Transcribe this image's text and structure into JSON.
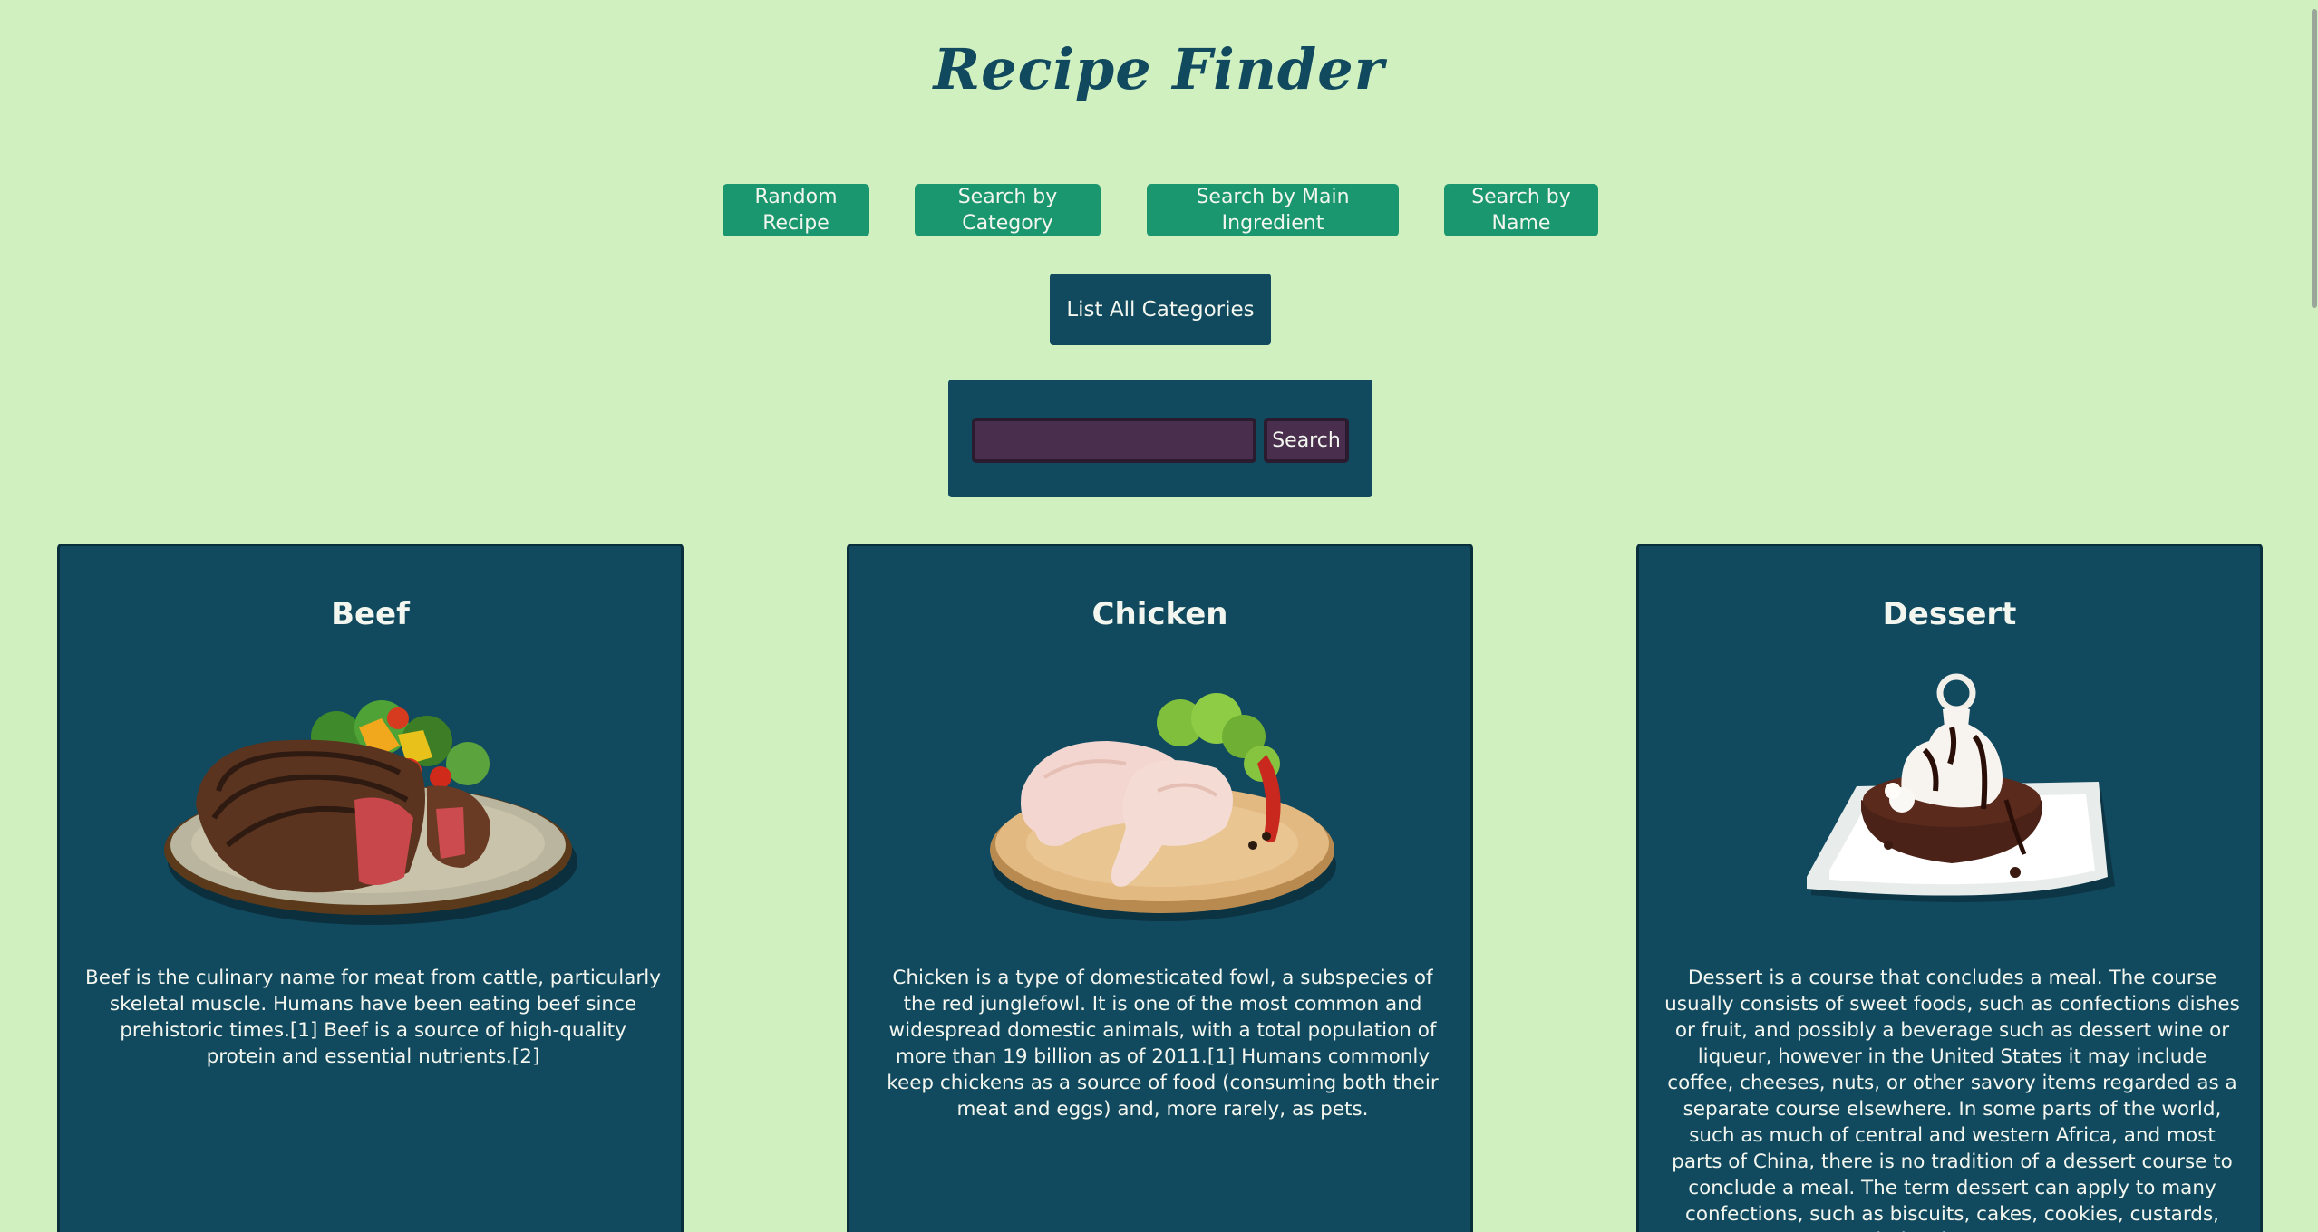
{
  "header": {
    "title": "Recipe Finder"
  },
  "buttons": {
    "random": [
      "Random",
      "Recipe"
    ],
    "category": [
      "Search by",
      "Category"
    ],
    "ingredient": [
      "Search by Main",
      "Ingredient"
    ],
    "name": [
      "Search by",
      "Name"
    ],
    "list_all": "List All Categories"
  },
  "search": {
    "value": "",
    "placeholder": "",
    "button_label": "Search"
  },
  "colors": {
    "background": "#d0f0c0",
    "primary": "#11495e",
    "accent_green": "#1b9770",
    "search_input": "#4a2e4e"
  },
  "categories": [
    {
      "name": "Beef",
      "image_icon": "beef-steak-image",
      "description": "Beef is the culinary name for meat from cattle, particularly skeletal muscle. Humans have been eating beef since prehistoric times.[1] Beef is a source of high-quality protein and essential nutrients.[2]"
    },
    {
      "name": "Chicken",
      "image_icon": "chicken-legs-image",
      "description": "Chicken is a type of domesticated fowl, a subspecies of the red junglefowl. It is one of the most common and widespread domestic animals, with a total population of more than 19 billion as of 2011.[1] Humans commonly keep chickens as a source of food (consuming both their meat and eggs) and, more rarely, as pets."
    },
    {
      "name": "Dessert",
      "image_icon": "chocolate-dessert-image",
      "description": "Dessert is a course that concludes a meal. The course usually consists of sweet foods, such as confections dishes or fruit, and possibly a beverage such as dessert wine or liqueur, however in the United States it may include coffee, cheeses, nuts, or other savory items regarded as a separate course elsewhere. In some parts of the world, such as much of central and western Africa, and most parts of China, there is no tradition of a dessert course to conclude a meal. The term dessert can apply to many confections, such as biscuits, cakes, cookies, custards, gelatins, ice creams,"
    }
  ]
}
